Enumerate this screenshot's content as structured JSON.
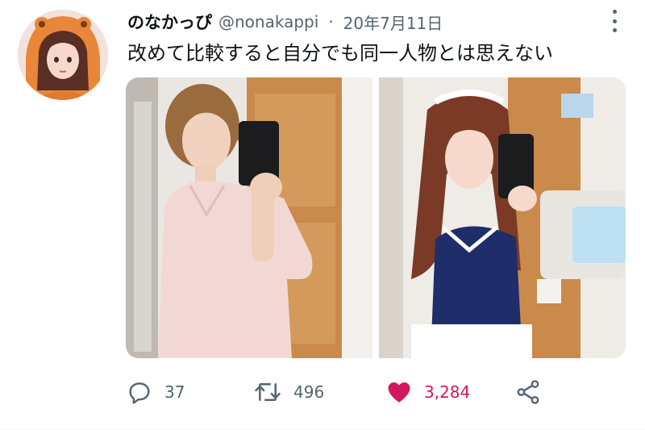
{
  "tweet": {
    "author_name": "のなかっぴ",
    "handle": "@nonakappi",
    "separator": "·",
    "date": "20年7月11日",
    "text": "改めて比較すると自分でも同一人物とは思えない"
  },
  "actions": {
    "reply_count": "37",
    "retweet_count": "496",
    "like_count": "3,284",
    "liked": true
  },
  "icons": {
    "more": "more-vertical-icon",
    "reply": "reply-icon",
    "retweet": "retweet-icon",
    "like": "heart-icon",
    "share": "share-icon"
  },
  "colors": {
    "text_primary": "#0f1419",
    "text_secondary": "#536471",
    "like_active": "#d3175f"
  }
}
